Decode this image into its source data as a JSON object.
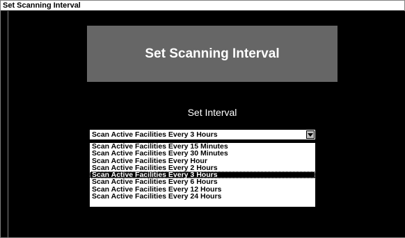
{
  "window": {
    "title": "Set Scanning Interval"
  },
  "banner": {
    "title": "Set Scanning Interval"
  },
  "interval": {
    "label": "Set Interval",
    "selected": "Scan Active Facilities Every 3 Hours",
    "options": [
      "Scan Active Facilities Every 15 Minutes",
      "Scan Active Facilities Every 30 Minutes",
      "Scan Active Facilities Every Hour",
      "Scan Active Facilities Every 2 Hours",
      "Scan Active Facilities Every 3 Hours",
      "Scan Active Facilities Every 6 Hours",
      "Scan Active Facilities Every 12 Hours",
      "Scan Active Facilities Every 24 Hours"
    ],
    "highlighted_index": 4
  },
  "icons": {
    "dropdown": "chevron-down-icon"
  }
}
